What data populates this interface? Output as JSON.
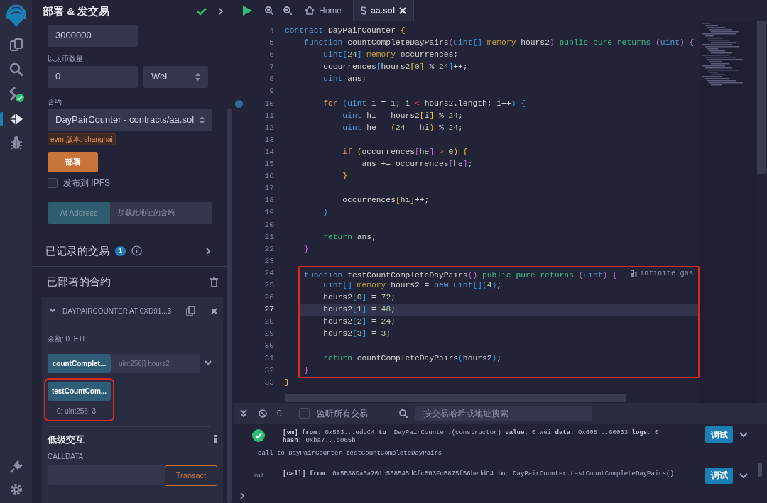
{
  "icon_bar": {
    "items": [
      {
        "kind": "logo",
        "selected": false
      },
      {
        "kind": "files",
        "selected": false
      },
      {
        "kind": "search",
        "selected": false
      },
      {
        "kind": "compiler",
        "selected": false
      },
      {
        "kind": "deploy",
        "selected": true
      },
      {
        "kind": "debugger",
        "selected": false
      },
      {
        "kind": "plugin",
        "selected": false
      },
      {
        "kind": "settings",
        "selected": false
      }
    ]
  },
  "side_panel": {
    "title": "部署 & 发交易",
    "gas_limit": "3000000",
    "value_label": "以太币数量",
    "value": "0",
    "unit": "Wei",
    "contract_label": "合约",
    "contract": "DayPairCounter - contracts/aa.sol",
    "evm_badge": "evm 版本: shanghai",
    "deploy_button": "部署",
    "publish_ipfs": {
      "label": "发布到 IPFS",
      "checked": false
    },
    "at_address_button": "At Address",
    "at_address_placeholder": "加载此地址的合约",
    "recorded": {
      "title": "已记录的交易",
      "count": "1"
    },
    "deployed": {
      "title": "已部署的合约",
      "instance": {
        "title": "DAYPAIRCOUNTER AT 0XD91...3",
        "expanded": true,
        "balance": "余额: 0. ETH",
        "functions": [
          {
            "kind": "input",
            "label": "countComplet...",
            "placeholder": "uint256[] hours2",
            "highlighted": false
          },
          {
            "kind": "call",
            "label": "testCountCom...",
            "result": "0: uint256: 3",
            "highlighted": true
          }
        ],
        "low_level": {
          "title": "低级交互",
          "calldata_label": "CALLDATA",
          "transact_button": "Transact"
        }
      }
    }
  },
  "tabs": [
    {
      "kind": "home",
      "label": "Home",
      "selected": false
    },
    {
      "kind": "file",
      "label": "aa.sol",
      "selected": true
    }
  ],
  "editor": {
    "lines": [
      {
        "kind": "line",
        "n": "4",
        "active": false,
        "breakpoint": false,
        "tokens": [
          {
            "kind": "kw",
            "text": "contract "
          },
          {
            "kind": "t",
            "text": "DayPairCounter "
          },
          {
            "kind": "y",
            "text": "{"
          }
        ]
      },
      {
        "kind": "line",
        "n": "5",
        "active": false,
        "breakpoint": false,
        "tokens": [
          {
            "kind": "kw",
            "text": "    function "
          },
          {
            "kind": "t",
            "text": "countCompleteDayPairs"
          },
          {
            "kind": "p",
            "text": "("
          },
          {
            "kind": "kw",
            "text": "uint"
          },
          {
            "kind": "b",
            "text": "[] "
          },
          {
            "kind": "mem",
            "text": "memory"
          },
          {
            "kind": "t",
            "text": " hours2"
          },
          {
            "kind": "p",
            "text": ") "
          },
          {
            "kind": "vis",
            "text": "public pure returns "
          },
          {
            "kind": "p",
            "text": "("
          },
          {
            "kind": "kw",
            "text": "uint"
          },
          {
            "kind": "p",
            "text": ") {"
          }
        ]
      },
      {
        "kind": "line",
        "n": "6",
        "active": false,
        "breakpoint": false,
        "tokens": [
          {
            "kind": "kw",
            "text": "        uint"
          },
          {
            "kind": "b",
            "text": "["
          },
          {
            "kind": "num",
            "text": "24"
          },
          {
            "kind": "b",
            "text": "] "
          },
          {
            "kind": "mem",
            "text": "memory"
          },
          {
            "kind": "t",
            "text": " occurrences;"
          }
        ]
      },
      {
        "kind": "line",
        "n": "7",
        "active": false,
        "breakpoint": false,
        "tokens": [
          {
            "kind": "t",
            "text": "        occurrences"
          },
          {
            "kind": "b",
            "text": "["
          },
          {
            "kind": "t",
            "text": "hours2"
          },
          {
            "kind": "y",
            "text": "["
          },
          {
            "kind": "num",
            "text": "0"
          },
          {
            "kind": "y",
            "text": "]"
          },
          {
            "kind": "t",
            "text": " % "
          },
          {
            "kind": "num",
            "text": "24"
          },
          {
            "kind": "b",
            "text": "]"
          },
          {
            "kind": "t",
            "text": "++;"
          }
        ]
      },
      {
        "kind": "line",
        "n": "8",
        "active": false,
        "breakpoint": false,
        "tokens": [
          {
            "kind": "kw",
            "text": "        uint"
          },
          {
            "kind": "t",
            "text": " ans;"
          }
        ]
      },
      {
        "kind": "line",
        "n": "9",
        "active": false,
        "breakpoint": false
      },
      {
        "kind": "line",
        "n": "10",
        "active": false,
        "breakpoint": true,
        "tokens": [
          {
            "kind": "ctl",
            "text": "        for "
          },
          {
            "kind": "b",
            "text": "("
          },
          {
            "kind": "kw",
            "text": "uint"
          },
          {
            "kind": "t",
            "text": " i = "
          },
          {
            "kind": "num",
            "text": "1"
          },
          {
            "kind": "t",
            "text": "; i "
          },
          {
            "kind": "op",
            "text": "<"
          },
          {
            "kind": "t",
            "text": " hours2.length; i++"
          },
          {
            "kind": "b",
            "text": ") {"
          }
        ]
      },
      {
        "kind": "line",
        "n": "11",
        "active": false,
        "breakpoint": false,
        "tokens": [
          {
            "kind": "kw",
            "text": "            uint"
          },
          {
            "kind": "t",
            "text": " hi = hours2"
          },
          {
            "kind": "y",
            "text": "["
          },
          {
            "kind": "t",
            "text": "i"
          },
          {
            "kind": "y",
            "text": "]"
          },
          {
            "kind": "t",
            "text": " % "
          },
          {
            "kind": "num",
            "text": "24"
          },
          {
            "kind": "t",
            "text": ";"
          }
        ]
      },
      {
        "kind": "line",
        "n": "12",
        "active": false,
        "breakpoint": false,
        "tokens": [
          {
            "kind": "kw",
            "text": "            uint"
          },
          {
            "kind": "t",
            "text": " he = "
          },
          {
            "kind": "y",
            "text": "("
          },
          {
            "kind": "num",
            "text": "24"
          },
          {
            "kind": "t",
            "text": " - hi"
          },
          {
            "kind": "y",
            "text": ")"
          },
          {
            "kind": "t",
            "text": " % "
          },
          {
            "kind": "num",
            "text": "24"
          },
          {
            "kind": "t",
            "text": ";"
          }
        ]
      },
      {
        "kind": "line",
        "n": "13",
        "active": false,
        "breakpoint": false
      },
      {
        "kind": "line",
        "n": "14",
        "active": false,
        "breakpoint": false,
        "tokens": [
          {
            "kind": "ctl",
            "text": "            if "
          },
          {
            "kind": "y",
            "text": "("
          },
          {
            "kind": "t",
            "text": "occurrences"
          },
          {
            "kind": "p",
            "text": "["
          },
          {
            "kind": "t",
            "text": "he"
          },
          {
            "kind": "p",
            "text": "]"
          },
          {
            "kind": "op",
            "text": " > "
          },
          {
            "kind": "num",
            "text": "0"
          },
          {
            "kind": "y",
            "text": ") {"
          }
        ]
      },
      {
        "kind": "line",
        "n": "15",
        "active": false,
        "breakpoint": false,
        "tokens": [
          {
            "kind": "t",
            "text": "                ans += occurrences"
          },
          {
            "kind": "p",
            "text": "["
          },
          {
            "kind": "t",
            "text": "he"
          },
          {
            "kind": "p",
            "text": "]"
          },
          {
            "kind": "t",
            "text": ";"
          }
        ]
      },
      {
        "kind": "line",
        "n": "16",
        "active": false,
        "breakpoint": false,
        "tokens": [
          {
            "kind": "y",
            "text": "            }"
          }
        ]
      },
      {
        "kind": "line",
        "n": "17",
        "active": false,
        "breakpoint": false
      },
      {
        "kind": "line",
        "n": "18",
        "active": false,
        "breakpoint": false,
        "tokens": [
          {
            "kind": "t",
            "text": "            occurrences"
          },
          {
            "kind": "y",
            "text": "["
          },
          {
            "kind": "t",
            "text": "hi"
          },
          {
            "kind": "y",
            "text": "]"
          },
          {
            "kind": "t",
            "text": "++;"
          }
        ]
      },
      {
        "kind": "line",
        "n": "19",
        "active": false,
        "breakpoint": false,
        "tokens": [
          {
            "kind": "b",
            "text": "        }"
          }
        ]
      },
      {
        "kind": "line",
        "n": "20",
        "active": false,
        "breakpoint": false
      },
      {
        "kind": "line",
        "n": "21",
        "active": false,
        "breakpoint": false,
        "tokens": [
          {
            "kind": "vis",
            "text": "        return"
          },
          {
            "kind": "t",
            "text": " ans;"
          }
        ]
      },
      {
        "kind": "line",
        "n": "22",
        "active": false,
        "breakpoint": false,
        "tokens": [
          {
            "kind": "p",
            "text": "    }"
          }
        ]
      },
      {
        "kind": "line",
        "n": "23",
        "active": false,
        "breakpoint": false
      },
      {
        "kind": "highlight",
        "lines": [
          {
            "kind": "line",
            "n": "24",
            "active": false,
            "breakpoint": false,
            "hint": "infinite gas",
            "tokens": [
              {
                "kind": "kw",
                "text": "    function "
              },
              {
                "kind": "t",
                "text": "testCountCompleteDayPairs"
              },
              {
                "kind": "p",
                "text": "() "
              },
              {
                "kind": "vis",
                "text": "public pure returns "
              },
              {
                "kind": "p",
                "text": "("
              },
              {
                "kind": "kw",
                "text": "uint"
              },
              {
                "kind": "p",
                "text": ") {"
              }
            ]
          },
          {
            "kind": "line",
            "n": "25",
            "active": false,
            "breakpoint": false,
            "tokens": [
              {
                "kind": "kw",
                "text": "        uint"
              },
              {
                "kind": "b",
                "text": "[] "
              },
              {
                "kind": "mem",
                "text": "memory"
              },
              {
                "kind": "t",
                "text": " hours2 = "
              },
              {
                "kind": "kw",
                "text": "new uint"
              },
              {
                "kind": "b",
                "text": "[]("
              },
              {
                "kind": "num",
                "text": "4"
              },
              {
                "kind": "b",
                "text": ")"
              },
              {
                "kind": "t",
                "text": ";"
              }
            ]
          },
          {
            "kind": "line",
            "n": "26",
            "active": false,
            "breakpoint": false,
            "tokens": [
              {
                "kind": "t",
                "text": "        hours2"
              },
              {
                "kind": "b",
                "text": "["
              },
              {
                "kind": "num",
                "text": "0"
              },
              {
                "kind": "b",
                "text": "]"
              },
              {
                "kind": "t",
                "text": " = "
              },
              {
                "kind": "num",
                "text": "72"
              },
              {
                "kind": "t",
                "text": ";"
              }
            ]
          },
          {
            "kind": "line",
            "n": "27",
            "active": true,
            "breakpoint": false,
            "tokens": [
              {
                "kind": "t",
                "text": "        hours2"
              },
              {
                "kind": "b",
                "text": "["
              },
              {
                "kind": "num",
                "text": "1"
              },
              {
                "kind": "b",
                "text": "]"
              },
              {
                "kind": "t",
                "text": " = "
              },
              {
                "kind": "num",
                "text": "48"
              },
              {
                "kind": "t",
                "text": ";"
              }
            ]
          },
          {
            "kind": "line",
            "n": "28",
            "active": false,
            "breakpoint": false,
            "tokens": [
              {
                "kind": "t",
                "text": "        hours2"
              },
              {
                "kind": "b",
                "text": "["
              },
              {
                "kind": "num",
                "text": "2"
              },
              {
                "kind": "b",
                "text": "]"
              },
              {
                "kind": "t",
                "text": " = "
              },
              {
                "kind": "num",
                "text": "24"
              },
              {
                "kind": "t",
                "text": ";"
              }
            ]
          },
          {
            "kind": "line",
            "n": "29",
            "active": false,
            "breakpoint": false,
            "tokens": [
              {
                "kind": "t",
                "text": "        hours2"
              },
              {
                "kind": "b",
                "text": "["
              },
              {
                "kind": "num",
                "text": "3"
              },
              {
                "kind": "b",
                "text": "]"
              },
              {
                "kind": "t",
                "text": " = "
              },
              {
                "kind": "num",
                "text": "3"
              },
              {
                "kind": "t",
                "text": ";"
              }
            ]
          },
          {
            "kind": "line",
            "n": "30",
            "active": false,
            "breakpoint": false
          },
          {
            "kind": "line",
            "n": "31",
            "active": false,
            "breakpoint": false,
            "tokens": [
              {
                "kind": "vis",
                "text": "        return"
              },
              {
                "kind": "t",
                "text": " countCompleteDayPairs"
              },
              {
                "kind": "b",
                "text": "("
              },
              {
                "kind": "t",
                "text": "hours2"
              },
              {
                "kind": "b",
                "text": ")"
              },
              {
                "kind": "t",
                "text": ";"
              }
            ]
          },
          {
            "kind": "line",
            "n": "32",
            "active": false,
            "breakpoint": false,
            "tokens": [
              {
                "kind": "p",
                "text": "    }"
              }
            ]
          }
        ]
      },
      {
        "kind": "line",
        "n": "33",
        "active": false,
        "breakpoint": false,
        "tokens": [
          {
            "kind": "y",
            "text": "}"
          }
        ]
      }
    ]
  },
  "terminal": {
    "pending_count": "0",
    "listen_all": {
      "label": "监听所有交易",
      "checked": false
    },
    "search_placeholder": "按交易哈希或地址搜索",
    "logs": [
      {
        "kind": "success",
        "text": "**[vm]  from**: 0x5B3...eddC4 **to**: DayPairCounter.(constructor) **value**: 0 wei **data**: 0x608...60033 **logs**: 0 **hash**: 0xba7...b065b",
        "debug_button": "调试",
        "note": "call to DayPairCounter.testCountCompleteDayPairs"
      },
      {
        "kind": "call",
        "badge": "call",
        "text": "**[call]  from**: 0x5B38Da6a701c568545dCfcB03FcB875f56beddC4 **to**: DayPairCounter.testCountCompleteDayPairs()",
        "debug_button": "调试"
      }
    ]
  }
}
